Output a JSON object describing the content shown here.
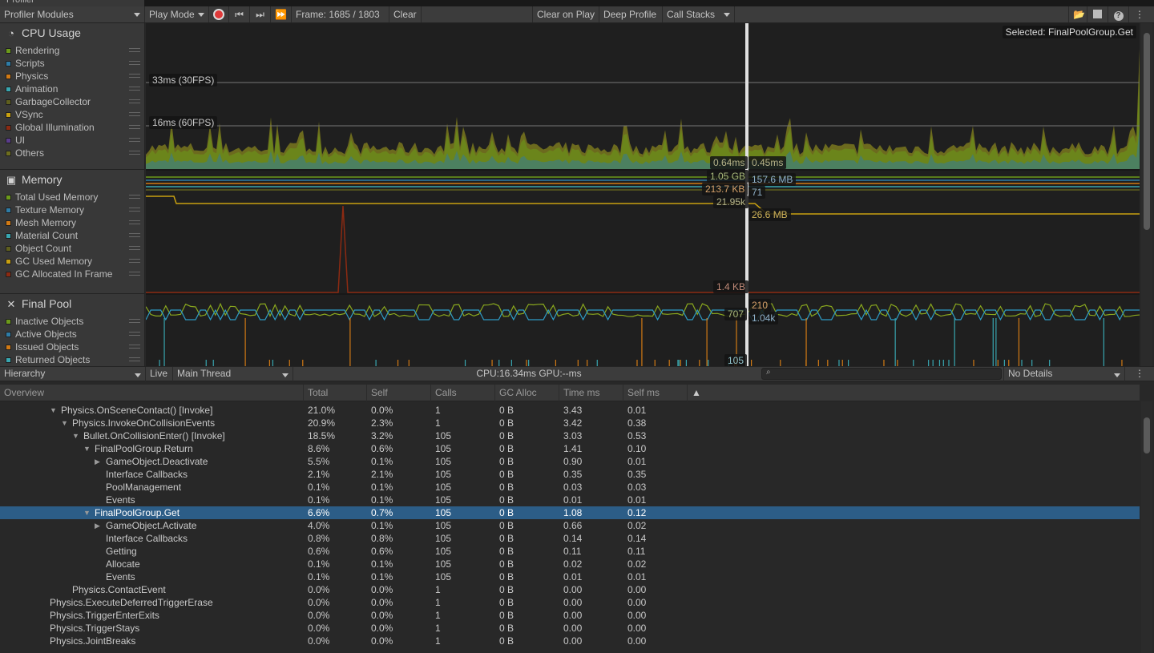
{
  "window": {
    "tab": "Profiler"
  },
  "toolbar": {
    "modules": "Profiler Modules",
    "play_mode": "Play Mode",
    "frame": "Frame: 1685 / 1803",
    "clear": "Clear",
    "clear_on_play": "Clear on Play",
    "deep_profile": "Deep Profile",
    "call_stacks": "Call Stacks"
  },
  "cpu": {
    "title": "CPU Usage",
    "legend": [
      {
        "name": "Rendering",
        "color": "#6c9a1a"
      },
      {
        "name": "Scripts",
        "color": "#2e7ca6"
      },
      {
        "name": "Physics",
        "color": "#d27a14"
      },
      {
        "name": "Animation",
        "color": "#38a6b0"
      },
      {
        "name": "GarbageCollector",
        "color": "#5f5f1e"
      },
      {
        "name": "VSync",
        "color": "#c8a010"
      },
      {
        "name": "Global Illumination",
        "color": "#8c2a12"
      },
      {
        "name": "UI",
        "color": "#5a3c8c"
      },
      {
        "name": "Others",
        "color": "#6e6e1e"
      }
    ],
    "line30": "33ms (30FPS)",
    "line60": "16ms (60FPS)",
    "selected": "Selected: FinalPoolGroup.Get",
    "val_left": "0.64ms",
    "val_right": "0.45ms"
  },
  "memory": {
    "title": "Memory",
    "legend": [
      {
        "name": "Total Used Memory",
        "color": "#6c9a1a"
      },
      {
        "name": "Texture Memory",
        "color": "#2e7ca6"
      },
      {
        "name": "Mesh Memory",
        "color": "#d27a14"
      },
      {
        "name": "Material Count",
        "color": "#38a6b0"
      },
      {
        "name": "Object Count",
        "color": "#5f5f1e"
      },
      {
        "name": "GC Used Memory",
        "color": "#c8a010"
      },
      {
        "name": "GC Allocated In Frame",
        "color": "#8c2a12"
      }
    ],
    "labels": {
      "total": "1.05 GB",
      "texture": "157.6 MB",
      "mesh": "213.7 KB",
      "material": "71",
      "object": "21.95k",
      "gc_used": "26.6 MB",
      "gc_alloc": "1.4 KB"
    }
  },
  "pool": {
    "title": "Final Pool",
    "legend": [
      {
        "name": "Inactive Objects",
        "color": "#6c9a1a"
      },
      {
        "name": "Active Objects",
        "color": "#2e7ca6"
      },
      {
        "name": "Issued Objects",
        "color": "#d27a14"
      },
      {
        "name": "Returned Objects",
        "color": "#38a6b0"
      }
    ],
    "labels": {
      "inactive": "707",
      "issued": "210",
      "active": "1.04k",
      "returned": "105"
    }
  },
  "hierarchy": {
    "view": "Hierarchy",
    "live": "Live",
    "thread": "Main Thread",
    "stats": "CPU:16.34ms  GPU:--ms",
    "search_placeholder": "",
    "details": "No Details",
    "columns": [
      "Overview",
      "Total",
      "Self",
      "Calls",
      "GC Alloc",
      "Time ms",
      "Self ms"
    ],
    "rows": [
      {
        "name": "Physics.OnSceneContact() [Invoke]",
        "depth": 1,
        "exp": "open",
        "v": [
          "21.0%",
          "0.0%",
          "1",
          "0 B",
          "3.43",
          "0.01"
        ]
      },
      {
        "name": "Physics.InvokeOnCollisionEvents",
        "depth": 2,
        "exp": "open",
        "v": [
          "20.9%",
          "2.3%",
          "1",
          "0 B",
          "3.42",
          "0.38"
        ]
      },
      {
        "name": "Bullet.OnCollisionEnter() [Invoke]",
        "depth": 3,
        "exp": "open",
        "v": [
          "18.5%",
          "3.2%",
          "105",
          "0 B",
          "3.03",
          "0.53"
        ]
      },
      {
        "name": "FinalPoolGroup.Return",
        "depth": 4,
        "exp": "open",
        "v": [
          "8.6%",
          "0.6%",
          "105",
          "0 B",
          "1.41",
          "0.10"
        ]
      },
      {
        "name": "GameObject.Deactivate",
        "depth": 5,
        "exp": "closed",
        "v": [
          "5.5%",
          "0.1%",
          "105",
          "0 B",
          "0.90",
          "0.01"
        ]
      },
      {
        "name": "Interface Callbacks",
        "depth": 5,
        "v": [
          "2.1%",
          "2.1%",
          "105",
          "0 B",
          "0.35",
          "0.35"
        ]
      },
      {
        "name": "PoolManagement",
        "depth": 5,
        "v": [
          "0.1%",
          "0.1%",
          "105",
          "0 B",
          "0.03",
          "0.03"
        ]
      },
      {
        "name": "Events",
        "depth": 5,
        "v": [
          "0.1%",
          "0.1%",
          "105",
          "0 B",
          "0.01",
          "0.01"
        ]
      },
      {
        "name": "FinalPoolGroup.Get",
        "depth": 4,
        "exp": "open",
        "selected": true,
        "v": [
          "6.6%",
          "0.7%",
          "105",
          "0 B",
          "1.08",
          "0.12"
        ]
      },
      {
        "name": "GameObject.Activate",
        "depth": 5,
        "exp": "closed",
        "v": [
          "4.0%",
          "0.1%",
          "105",
          "0 B",
          "0.66",
          "0.02"
        ]
      },
      {
        "name": "Interface Callbacks",
        "depth": 5,
        "v": [
          "0.8%",
          "0.8%",
          "105",
          "0 B",
          "0.14",
          "0.14"
        ]
      },
      {
        "name": "Getting",
        "depth": 5,
        "v": [
          "0.6%",
          "0.6%",
          "105",
          "0 B",
          "0.11",
          "0.11"
        ]
      },
      {
        "name": "Allocate",
        "depth": 5,
        "v": [
          "0.1%",
          "0.1%",
          "105",
          "0 B",
          "0.02",
          "0.02"
        ]
      },
      {
        "name": "Events",
        "depth": 5,
        "v": [
          "0.1%",
          "0.1%",
          "105",
          "0 B",
          "0.01",
          "0.01"
        ]
      },
      {
        "name": "Physics.ContactEvent",
        "depth": 2,
        "v": [
          "0.0%",
          "0.0%",
          "1",
          "0 B",
          "0.00",
          "0.00"
        ]
      },
      {
        "name": "Physics.ExecuteDeferredTriggerErase",
        "depth": 0,
        "v": [
          "0.0%",
          "0.0%",
          "1",
          "0 B",
          "0.00",
          "0.00"
        ]
      },
      {
        "name": "Physics.TriggerEnterExits",
        "depth": 0,
        "v": [
          "0.0%",
          "0.0%",
          "1",
          "0 B",
          "0.00",
          "0.00"
        ]
      },
      {
        "name": "Physics.TriggerStays",
        "depth": 0,
        "v": [
          "0.0%",
          "0.0%",
          "1",
          "0 B",
          "0.00",
          "0.00"
        ]
      },
      {
        "name": "Physics.JointBreaks",
        "depth": 0,
        "v": [
          "0.0%",
          "0.0%",
          "1",
          "0 B",
          "0.00",
          "0.00"
        ]
      }
    ]
  }
}
